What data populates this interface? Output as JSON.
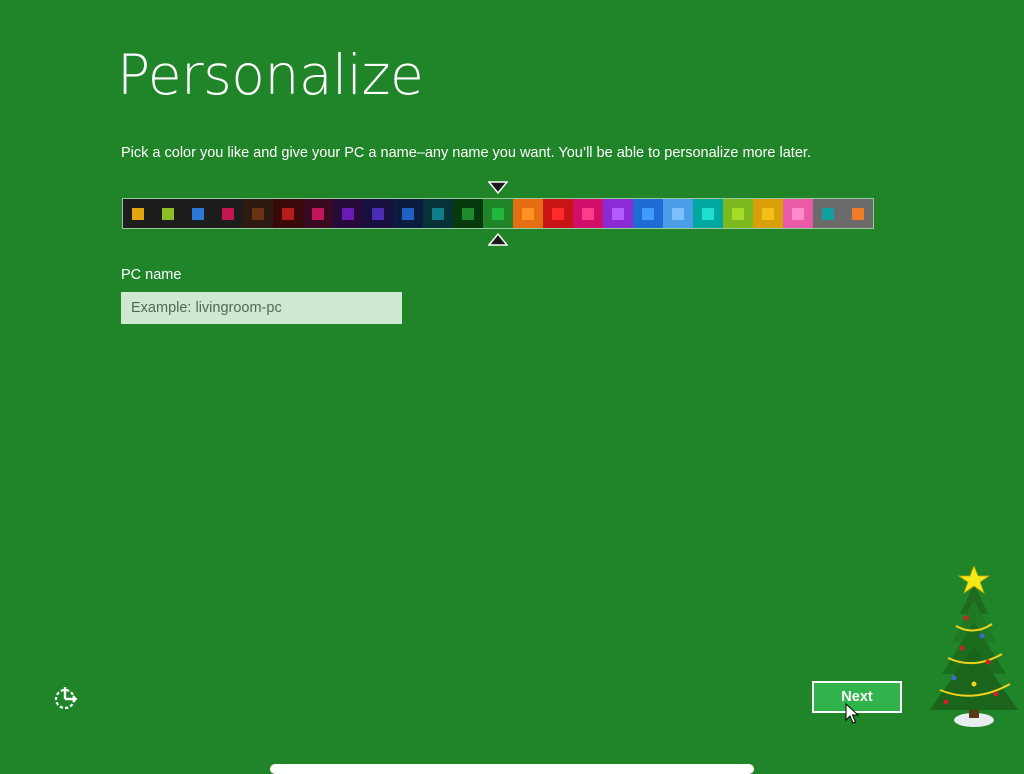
{
  "header": {
    "title": "Personalize"
  },
  "instructions": "Pick a color you like and give your PC a name–any name you want. You’ll be able to personalize more later.",
  "color_picker": {
    "selected_index": 12,
    "swatches": [
      {
        "bg": "#1d1d1d",
        "chip": "#e2a710"
      },
      {
        "bg": "#1d1d1d",
        "chip": "#8cbf26"
      },
      {
        "bg": "#1d1d1d",
        "chip": "#2b77d6"
      },
      {
        "bg": "#1d1d1d",
        "chip": "#c4174f"
      },
      {
        "bg": "#2e1a10",
        "chip": "#6a3514"
      },
      {
        "bg": "#3a0a0a",
        "chip": "#b71c1c"
      },
      {
        "bg": "#3a0a20",
        "chip": "#c2185b"
      },
      {
        "bg": "#260a3a",
        "chip": "#6a1bb5"
      },
      {
        "bg": "#170f3e",
        "chip": "#4a2cb5"
      },
      {
        "bg": "#0a1d3e",
        "chip": "#1f62c4"
      },
      {
        "bg": "#063238",
        "chip": "#0f7e8a"
      },
      {
        "bg": "#053a0d",
        "chip": "#1e8c2c"
      },
      {
        "bg": "#1f8528",
        "chip": "#20b83a"
      },
      {
        "bg": "#e56e12",
        "chip": "#ff9224"
      },
      {
        "bg": "#c81414",
        "chip": "#ff2a2a"
      },
      {
        "bg": "#d10e6a",
        "chip": "#ff3c8c"
      },
      {
        "bg": "#8a2bd6",
        "chip": "#b25cff"
      },
      {
        "bg": "#1f6bd6",
        "chip": "#3f9bff"
      },
      {
        "bg": "#4a9ee8",
        "chip": "#7cc0ff"
      },
      {
        "bg": "#00a8a0",
        "chip": "#1de0d0"
      },
      {
        "bg": "#7dba1f",
        "chip": "#a6dc2a"
      },
      {
        "bg": "#d9a00a",
        "chip": "#f2bf18"
      },
      {
        "bg": "#ea5aa8",
        "chip": "#ff8cc8"
      },
      {
        "bg": "#6b6b6b",
        "chip": "#11a0a0"
      },
      {
        "bg": "#6b6b6b",
        "chip": "#f07c28"
      }
    ]
  },
  "pc_name": {
    "label": "PC name",
    "value": "",
    "placeholder": "Example: livingroom-pc"
  },
  "footer": {
    "next_label": "Next",
    "ease_of_access_icon": "ease-of-access-icon"
  },
  "colors": {
    "background": "#1f8528",
    "next_button_bg": "#2fb34a",
    "input_bg": "#cfe8d1"
  }
}
